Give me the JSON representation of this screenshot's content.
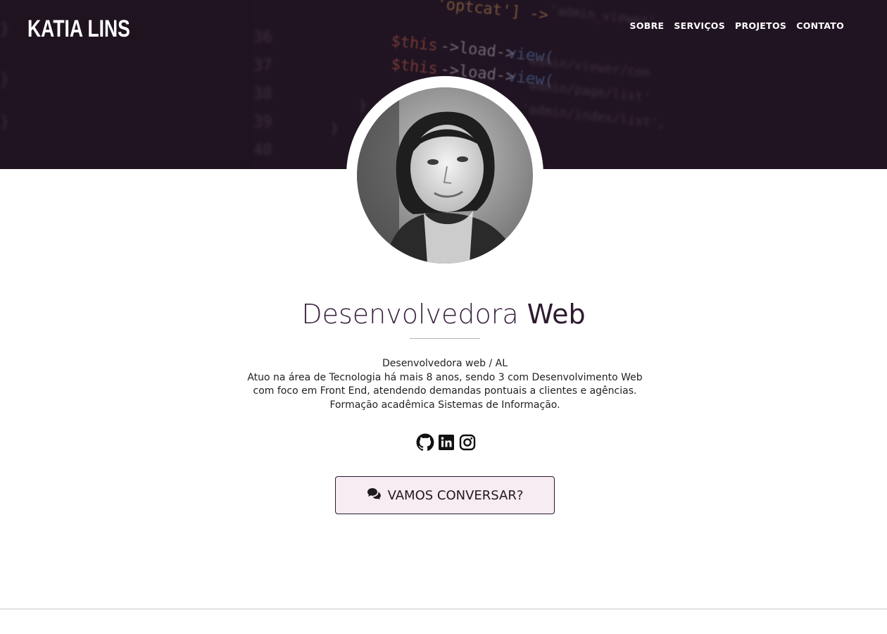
{
  "header": {
    "brand": "KATIA LINS",
    "nav": [
      {
        "label": "SOBRE"
      },
      {
        "label": "SERVIÇOS"
      },
      {
        "label": "PROJETOS"
      },
      {
        "label": "CONTATO"
      }
    ],
    "background_code": [
      "$this->load->view(",
      "$this->load->view(",
      "optcat'] ->"
    ]
  },
  "hero": {
    "title_light": "Desenvolvedora",
    "title_strong": "Web",
    "subtitle": "Desenvolvedora web / AL",
    "description_lines": [
      "Atuo na área de Tecnologia há mais 8 anos, sendo 3 com Desenvolvimento Web",
      "com foco em Front End, atendendo demandas pontuais a clientes e agências.",
      "Formação acadêmica Sistemas de Informação."
    ]
  },
  "social": [
    {
      "icon": "github-icon"
    },
    {
      "icon": "linkedin-icon"
    },
    {
      "icon": "instagram-icon"
    }
  ],
  "cta": {
    "label": "VAMOS CONVERSAR?",
    "icon": "comments-icon"
  },
  "colors": {
    "accent": "#2e1a31",
    "button_bg": "#f6ecf1"
  }
}
